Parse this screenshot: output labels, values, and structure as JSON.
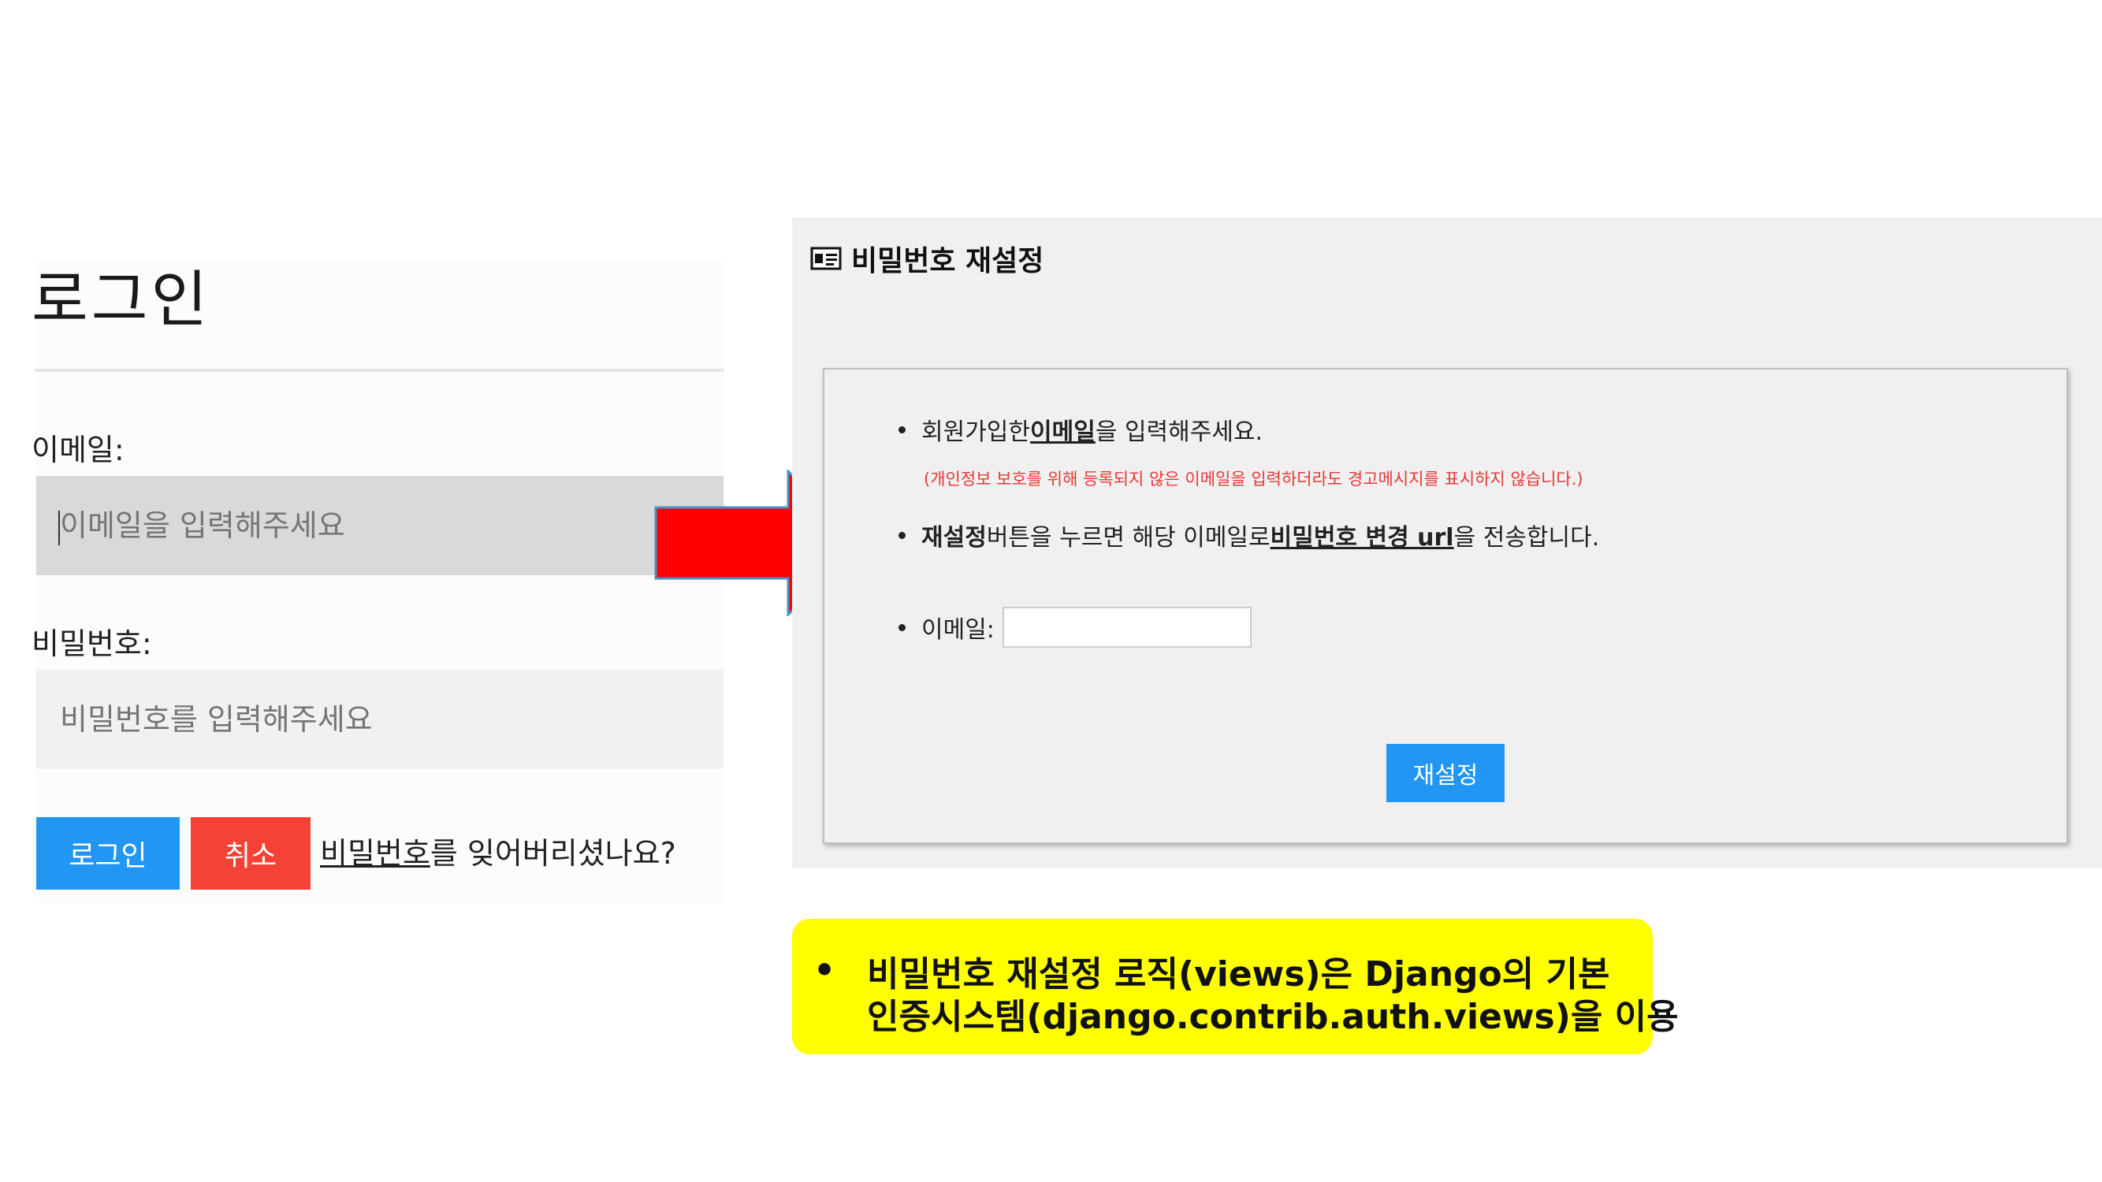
{
  "login": {
    "title": "로그인",
    "email_label": "이메일:",
    "email_placeholder": "이메일을 입력해주세요",
    "password_label": "비밀번호:",
    "password_placeholder": "비밀번호를 입력해주세요",
    "login_button": "로그인",
    "cancel_button": "취소",
    "forgot_link": "비밀번호",
    "forgot_suffix": "를 잊어버리셨나요?"
  },
  "reset": {
    "title": "비밀번호 재설정",
    "icon": "id-card-icon",
    "line1_prefix": "회원가입한 ",
    "line1_bold": "이메일",
    "line1_suffix": "을 입력해주세요.",
    "warning": "(개인정보 보호를 위해 등록되지 않은 이메일을 입력하더라도 경고메시지를 표시하지 않습니다.)",
    "line2_bold": "재설정",
    "line2_mid": " 버튼을 누르면 해당 이메일로 ",
    "line2_link": "비밀번호 변경 url",
    "line2_suffix": "을 전송합니다.",
    "email_label": "이메일:",
    "email_value": "",
    "button": "재설정"
  },
  "note": {
    "bullet": "•",
    "line1": "비밀번호 재설정 로직(views)은 Django의 기본",
    "line2": "인증시스템(django.contrib.auth.views)을 이용"
  },
  "colors": {
    "primary_blue": "#2196f3",
    "danger_red": "#f44336",
    "arrow_red": "#ff0000",
    "note_yellow": "#ffff00",
    "warning_text": "#e53935"
  }
}
